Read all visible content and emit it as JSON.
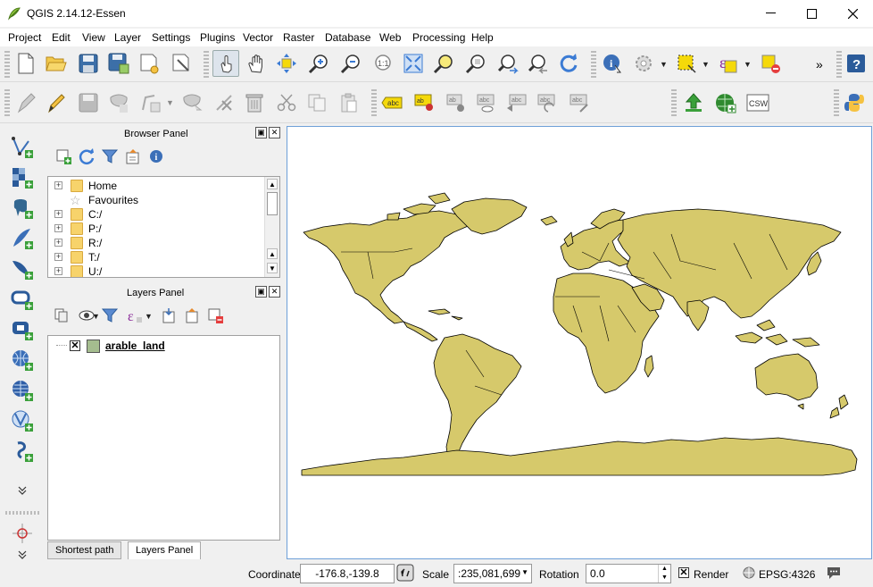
{
  "window": {
    "title": "QGIS 2.14.12-Essen",
    "minimize_glyph": "minimize-icon",
    "maximize_glyph": "maximize-icon",
    "close_glyph": "close-icon"
  },
  "menu": {
    "items": [
      "Project",
      "Edit",
      "View",
      "Layer",
      "Settings",
      "Plugins",
      "Vector",
      "Raster",
      "Database",
      "Web",
      "Processing",
      "Help"
    ]
  },
  "toolbar": {
    "overflow_label": "»",
    "csw_label": "CSW",
    "abc_label": "abc"
  },
  "browser_panel": {
    "title": "Browser Panel",
    "items": [
      {
        "label": "Home",
        "type": "folder",
        "expandable": true
      },
      {
        "label": "Favourites",
        "type": "star",
        "expandable": false
      },
      {
        "label": "C:/",
        "type": "folder",
        "expandable": true
      },
      {
        "label": "P:/",
        "type": "folder",
        "expandable": true
      },
      {
        "label": "R:/",
        "type": "folder",
        "expandable": true
      },
      {
        "label": "T:/",
        "type": "folder",
        "expandable": true
      },
      {
        "label": "U:/",
        "type": "folder",
        "expandable": true
      }
    ]
  },
  "layers_panel": {
    "title": "Layers Panel",
    "layers": [
      {
        "name": "arable_land",
        "checked": true,
        "color": "#a5bd8f"
      }
    ]
  },
  "bottom_tabs": [
    "Shortest path",
    "Layers Panel"
  ],
  "map": {
    "land_color": "#d6c96b",
    "outline_color": "#000000",
    "background": "#ffffff"
  },
  "statusbar": {
    "coordinate_label": "Coordinate",
    "coordinate_value": "-176.8,-139.8",
    "scale_label": "Scale",
    "scale_value": ":235,081,699",
    "rotation_label": "Rotation",
    "rotation_value": "0.0",
    "render_label": "Render",
    "render_checked": true,
    "crs_label": "EPSG:4326"
  }
}
